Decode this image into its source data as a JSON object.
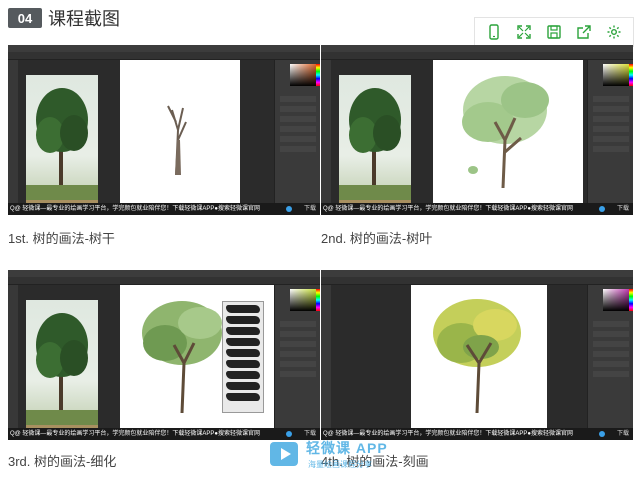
{
  "header": {
    "badge": "04",
    "title": "课程截图"
  },
  "toolbar": {
    "icons": [
      "phone-icon",
      "fullscreen-icon",
      "save-icon",
      "share-icon",
      "settings-icon"
    ],
    "accent": "#2aa33a"
  },
  "tiles": [
    {
      "caption": "1st. 树的画法-树干",
      "footer": "Q@ 轻微课—最专业的绘画学习平台，学完颜包就业陪伴您！下载轻微课APP●搜索轻微课官网",
      "footer_right": "下载"
    },
    {
      "caption": "2nd. 树的画法-树叶",
      "footer": "Q@ 轻微课—最专业的绘画学习平台，学完颜包就业陪伴您！下载轻微课APP●搜索轻微课官网",
      "footer_right": "下载"
    },
    {
      "caption": "3rd. 树的画法-细化",
      "footer": "Q@ 轻微课—最专业的绘画学习平台，学完颜包就业陪伴您！下载轻微课APP●搜索轻微课官网",
      "footer_right": "下载"
    },
    {
      "caption": "4th. 树的画法-刻画",
      "footer": "Q@ 轻微课—最专业的绘画学习平台，学完颜包就业陪伴您！下载轻微课APP●搜索轻微课官网",
      "footer_right": "下载"
    }
  ],
  "watermark": {
    "title": "轻微课 APP",
    "subtitle": "海量绘画课程分享"
  }
}
